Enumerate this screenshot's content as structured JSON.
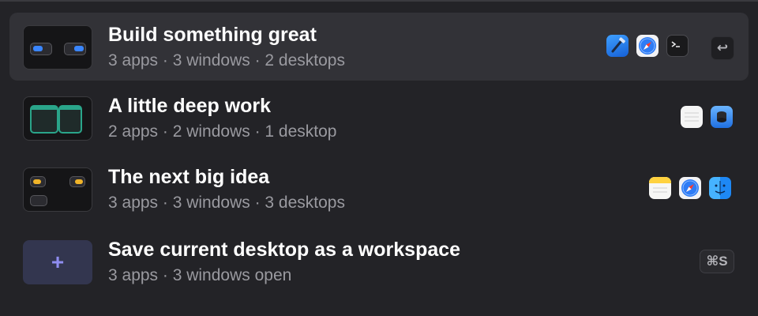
{
  "workspaces": [
    {
      "title": "Build something great",
      "subtitle": "3 apps · 3 windows · 2 desktops",
      "apps": [
        "xcode-icon",
        "safari-icon",
        "terminal-icon"
      ],
      "shortcut": "↩",
      "selected": true
    },
    {
      "title": "A little deep work",
      "subtitle": "2 apps · 2 windows · 1 desktop",
      "apps": [
        "notes-lines-icon",
        "disk-utility-icon"
      ],
      "selected": false
    },
    {
      "title": "The next big idea",
      "subtitle": "3 apps · 3 windows · 3 desktops",
      "apps": [
        "notes-icon",
        "safari-icon",
        "finder-icon"
      ],
      "selected": false
    }
  ],
  "save_action": {
    "title": "Save current desktop as a workspace",
    "subtitle": "3 apps · 3 windows open",
    "shortcut": "⌘S",
    "plus": "+"
  },
  "colors": {
    "background": "#232327",
    "selected_row": "#323237",
    "accent_plus": "#8f8df0",
    "teal_window": "#2aa58a",
    "blue_pill": "#3a86ff",
    "amber_pill": "#f0b429"
  }
}
